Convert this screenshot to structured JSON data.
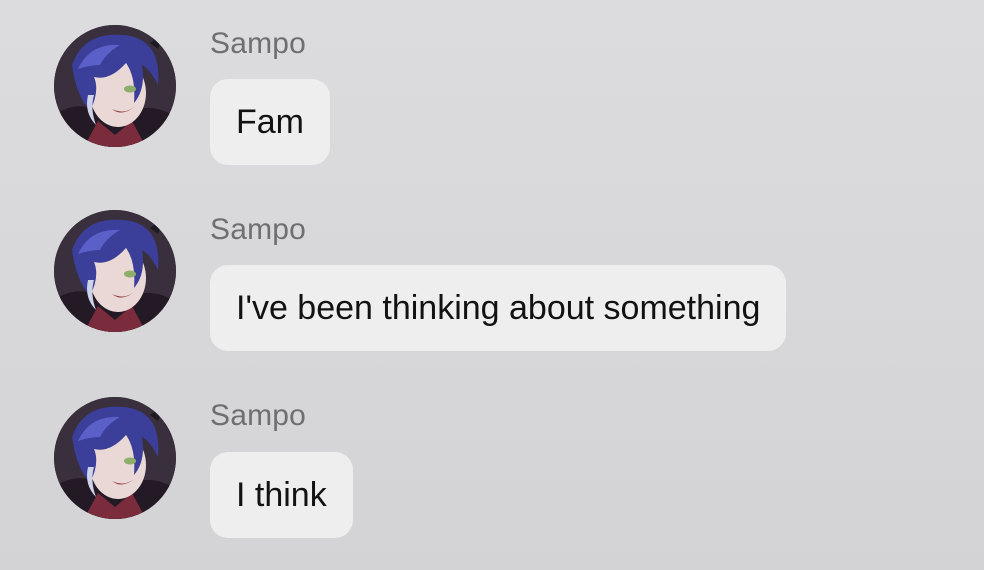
{
  "conversation": {
    "messages": [
      {
        "sender": "Sampo",
        "text": "Fam",
        "avatar_icon": "character-avatar-icon"
      },
      {
        "sender": "Sampo",
        "text": "I've been thinking about something",
        "avatar_icon": "character-avatar-icon"
      },
      {
        "sender": "Sampo",
        "text": "I think",
        "avatar_icon": "character-avatar-icon"
      }
    ]
  },
  "colors": {
    "background": "#d9d9db",
    "bubble": "#eeeeef",
    "sender_name": "#6f6f72",
    "message_text": "#121212"
  }
}
